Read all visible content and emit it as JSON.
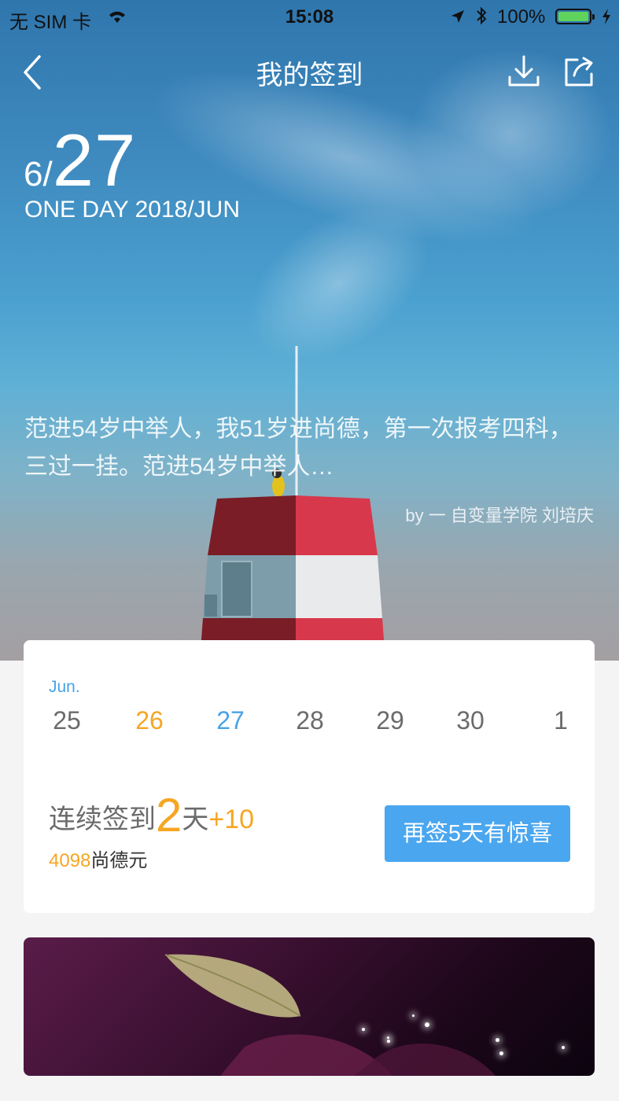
{
  "status_bar": {
    "carrier": "无 SIM 卡",
    "time": "15:08",
    "battery_pct": "100%"
  },
  "nav": {
    "title": "我的签到"
  },
  "hero": {
    "month": "6/",
    "day": "27",
    "subtitle": "ONE DAY 2018/JUN",
    "quote_line1": "范进54岁中举人，我51岁进尚德，第一次报考四科，",
    "quote_line2": "三过一挂。范进54岁中举人…",
    "author": "by 一 自变量学院 刘培庆"
  },
  "calendar": {
    "month_label": "Jun.",
    "days": [
      {
        "label": "25",
        "state": "past"
      },
      {
        "label": "26",
        "state": "signed",
        "color": "#f5a623"
      },
      {
        "label": "27",
        "state": "today",
        "color": "#4aa3e6"
      },
      {
        "label": "28",
        "state": "future"
      },
      {
        "label": "29",
        "state": "future"
      },
      {
        "label": "30",
        "state": "future"
      },
      {
        "label": "1",
        "state": "future"
      }
    ],
    "streak_prefix": "连续签到",
    "streak_days": "2",
    "streak_unit": "天",
    "streak_bonus": "+10",
    "coins_value": "4098",
    "coins_unit": "尚德元",
    "cta_label": "再签5天有惊喜"
  },
  "colors": {
    "accent_blue": "#4aa6ef",
    "accent_orange": "#f5a623",
    "text_gray": "#6b6b6b"
  }
}
